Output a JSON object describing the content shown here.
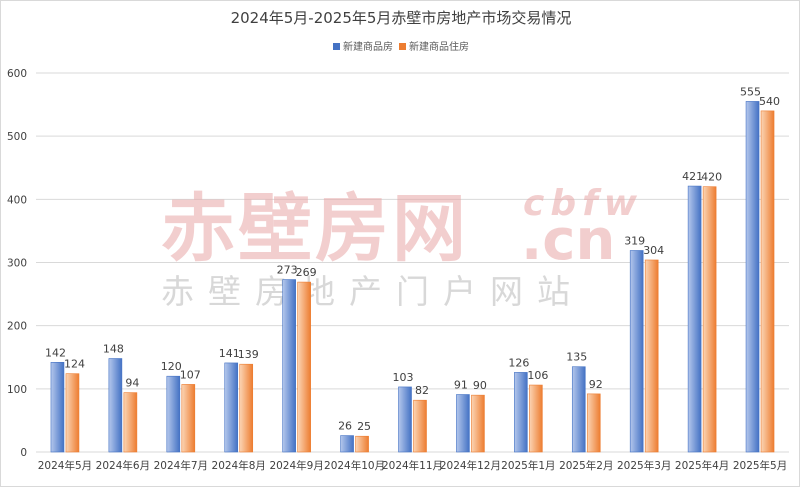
{
  "title": "2024年5月-2025年5月赤壁市房地产市场交易情况",
  "watermark": {
    "main": "赤壁房网",
    "latin": "cbfw",
    "domain": ".cn",
    "sub": "赤壁房地产门户网站"
  },
  "colors": {
    "series1_light": "#b4c7ec",
    "series1_dark": "#4472c4",
    "series2_light": "#fbd5b5",
    "series2_dark": "#ed7d31",
    "gridline": "#d9d9d9"
  },
  "chart_data": {
    "type": "bar",
    "title": "2024年5月-2025年5月赤壁市房地产市场交易情况",
    "xlabel": "",
    "ylabel": "",
    "ylim": [
      0,
      600
    ],
    "yticks": [
      0,
      100,
      200,
      300,
      400,
      500,
      600
    ],
    "grid": true,
    "legend_position": "top-center",
    "categories": [
      "2024年5月",
      "2024年6月",
      "2024年7月",
      "2024年8月",
      "2024年9月",
      "2024年10月",
      "2024年11月",
      "2024年12月",
      "2025年1月",
      "2025年2月",
      "2025年3月",
      "2025年4月",
      "2025年5月"
    ],
    "series": [
      {
        "name": "新建商品房",
        "values": [
          142,
          148,
          120,
          141,
          273,
          26,
          103,
          91,
          126,
          135,
          319,
          421,
          555
        ]
      },
      {
        "name": "新建商品住房",
        "values": [
          124,
          94,
          107,
          139,
          269,
          25,
          82,
          90,
          106,
          92,
          304,
          420,
          540
        ]
      }
    ]
  }
}
